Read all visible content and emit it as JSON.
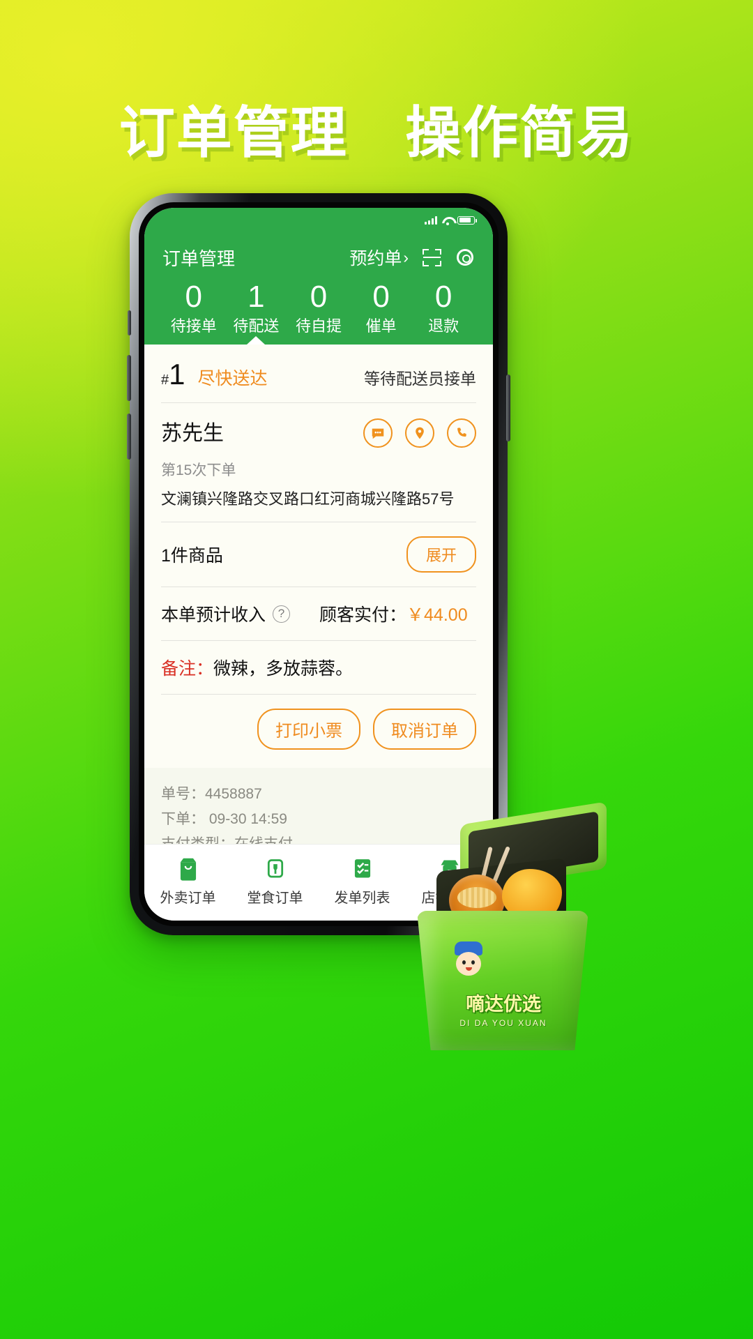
{
  "poster": {
    "headline_part1": "订单管理",
    "headline_part2": "操作简易"
  },
  "statusbar": {
    "signal_icon": "signal-bars-icon",
    "wifi_icon": "wifi-icon",
    "battery_icon": "battery-icon"
  },
  "appbar": {
    "title": "订单管理",
    "reservation_label": "预约单",
    "chevron": "›",
    "scan_icon": "scan-icon",
    "settings_icon": "gear-icon"
  },
  "tabs": [
    {
      "count": "0",
      "label": "待接单",
      "active": false
    },
    {
      "count": "1",
      "label": "待配送",
      "active": true
    },
    {
      "count": "0",
      "label": "待自提",
      "active": false
    },
    {
      "count": "0",
      "label": "催单",
      "active": false
    },
    {
      "count": "0",
      "label": "退款",
      "active": false
    }
  ],
  "order": {
    "hash": "#",
    "index": "1",
    "urgency": "尽快送达",
    "status": "等待配送员接单",
    "customer_name": "苏先生",
    "order_times": "第15次下单",
    "address": "文澜镇兴隆路交叉路口红河商城兴隆路57号",
    "actions": {
      "message_icon": "message-icon",
      "location_icon": "location-pin-icon",
      "phone_icon": "phone-icon"
    },
    "goods_count": "1件商品",
    "expand_label": "展开",
    "income_label": "本单预计收入",
    "help_icon": "question-mark-icon",
    "paid_label": "顾客实付：",
    "paid_amount": "￥44.00",
    "note_key": "备注：",
    "note_value": "微辣，多放蒜蓉。",
    "print_label": "打印小票",
    "cancel_label": "取消订单",
    "meta": [
      "单号：4458887",
      "下单： 09-30  14:59",
      "支付类型：在线支付"
    ]
  },
  "bottom_nav": [
    {
      "label": "外卖订单",
      "icon": "takeout-bag-icon"
    },
    {
      "label": "堂食订单",
      "icon": "dine-in-icon"
    },
    {
      "label": "发单列表",
      "icon": "invoice-list-icon"
    },
    {
      "label": "店铺管理",
      "icon": "shop-icon"
    }
  ],
  "mascot": {
    "brand_cn": "嘀达优选",
    "brand_en": "DI DA YOU XUAN"
  },
  "colors": {
    "brand_green": "#2ea949",
    "accent_orange": "#ef8b1f",
    "note_red": "#d93025",
    "poster_bg_from": "#d6ee1f",
    "poster_bg_to": "#12c906"
  }
}
